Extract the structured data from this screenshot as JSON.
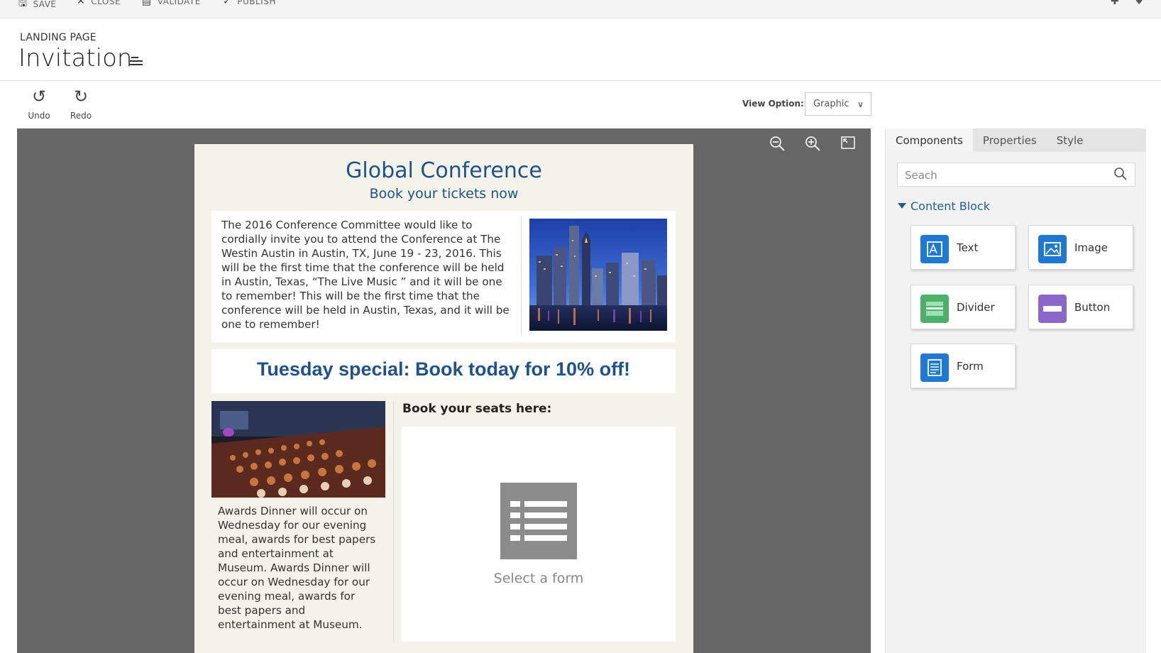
{
  "commandbar": {
    "save": "SAVE",
    "close": "CLOSE",
    "validate": "VALIDATE",
    "publish": "PUBLISH"
  },
  "header": {
    "entity": "LANDING PAGE",
    "title": "Invitation"
  },
  "toolbar": {
    "undo": "Undo",
    "redo": "Redo",
    "view_option_label": "View Option:",
    "view_option_value": "Graphic"
  },
  "page": {
    "title": "Global Conference",
    "subtitle": "Book your tickets now",
    "intro": "The 2016 Conference Committee would like to cordially invite you to attend the Conference at The Westin Austin in Austin, TX, June 19 - 23, 2016. This will be the first time that the conference will be held in Austin, Texas, “The Live Music ” and it will be one to remember! This will be the first time that the conference will be held in Austin, Texas, and it will be one to remember!",
    "banner": "Tuesday special: Book today for 10% off!",
    "dinner": "Awards Dinner will occur on Wednesday for our evening meal, awards for best papers and entertainment at Museum. Awards Dinner will occur on Wednesday for our evening meal, awards for best papers and entertainment at Museum.",
    "seats_label": "Book  your seats here:",
    "form_placeholder": "Select a form"
  },
  "panel": {
    "tabs": [
      "Components",
      "Properties",
      "Style"
    ],
    "search_placeholder": "Seach",
    "section": "Content Block",
    "components": [
      {
        "label": "Text",
        "color": "#1f78d1",
        "icon": "text-icon"
      },
      {
        "label": "Image",
        "color": "#1f78d1",
        "icon": "image-icon"
      },
      {
        "label": "Divider",
        "color": "#4caf6a",
        "icon": "divider-icon"
      },
      {
        "label": "Button",
        "color": "#8a67c9",
        "icon": "button-icon"
      },
      {
        "label": "Form",
        "color": "#1f78d1",
        "icon": "form-icon"
      }
    ]
  }
}
